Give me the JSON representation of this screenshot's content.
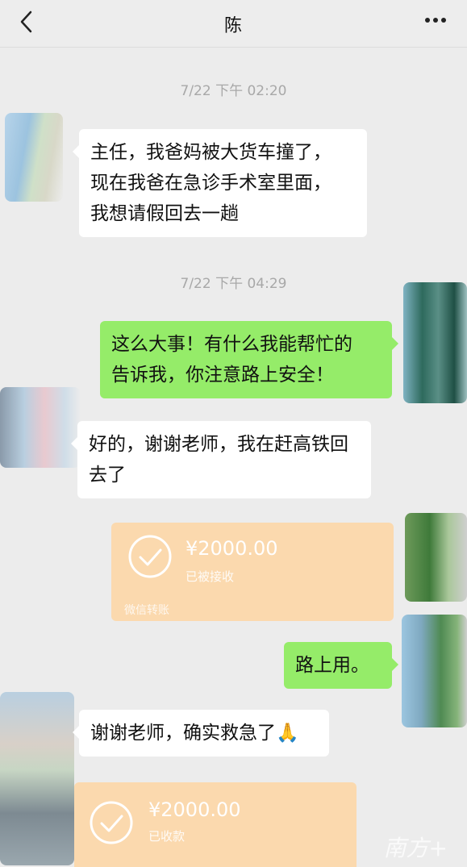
{
  "header": {
    "title": "陈",
    "back_icon": "chevron-left-icon",
    "more_icon": "ellipsis-icon"
  },
  "messages": [
    {
      "timestamp": "7/22 下午 02:20"
    },
    {
      "side": "in",
      "text_lines": [
        "主任，我爸妈被大货车撞了，",
        "现在我爸在急诊手术室里面，",
        "我想请假回去一趟"
      ]
    },
    {
      "timestamp": "7/22 下午 04:29"
    },
    {
      "side": "out",
      "text_lines": [
        "这么大事！有什么我能帮忙的",
        "告诉我，你注意路上安全！"
      ]
    },
    {
      "side": "in",
      "text_lines": [
        "好的，谢谢老师，我在赶高铁回",
        "去了"
      ]
    },
    {
      "side": "out",
      "type": "transfer",
      "amount": "¥2000.00",
      "status": "已被接收",
      "footer": "微信转账"
    },
    {
      "side": "out",
      "text_lines": [
        "路上用。"
      ]
    },
    {
      "side": "in",
      "text_lines": [
        "谢谢老师，确实救急了🙏"
      ]
    },
    {
      "side": "in",
      "type": "transfer",
      "amount": "¥2000.00",
      "status": "已收款"
    }
  ],
  "watermark": "南方+",
  "colors": {
    "background": "#ececec",
    "incoming_bubble": "#ffffff",
    "outgoing_bubble": "#95ec69",
    "transfer_card": "#fbd9ae",
    "timestamp": "#a8a8a8"
  }
}
